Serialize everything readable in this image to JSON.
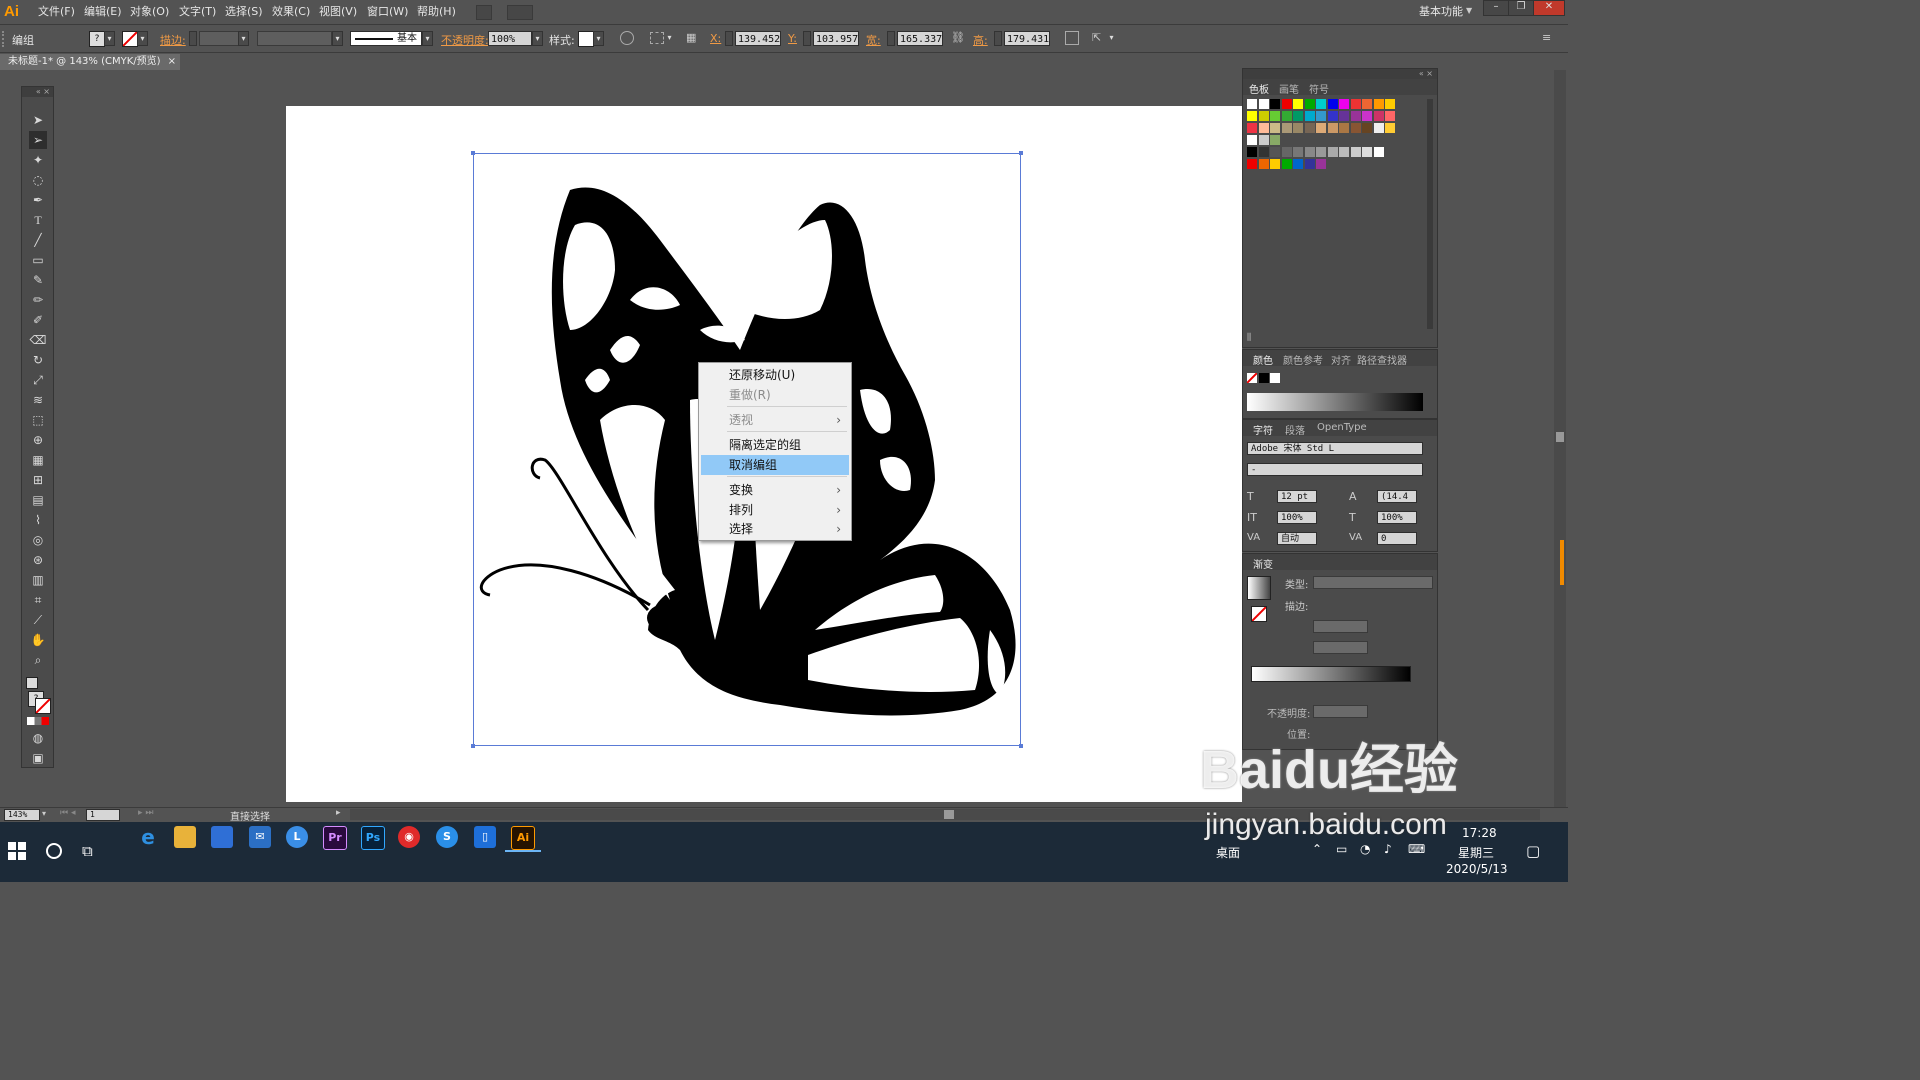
{
  "app": {
    "logo": "Ai",
    "workspace": "基本功能"
  },
  "menu": [
    "文件(F)",
    "编辑(E)",
    "对象(O)",
    "文字(T)",
    "选择(S)",
    "效果(C)",
    "视图(V)",
    "窗口(W)",
    "帮助(H)"
  ],
  "control_bar": {
    "selection_label": "编组",
    "stroke_label": "描边:",
    "stroke_style": "基本",
    "opacity_label": "不透明度:",
    "opacity_value": "100%",
    "style_label": "样式:",
    "x_label": "X:",
    "x_value": "139.452 ",
    "y_label": "Y:",
    "y_value": "103.957 ",
    "w_label": "宽:",
    "w_value": "165.337 ",
    "h_label": "高:",
    "h_value": "179.431 "
  },
  "document_tab": {
    "title": "未标题-1* @ 143% (CMYK/预览)",
    "close": "×"
  },
  "context_menu": {
    "items": [
      {
        "label": "还原移动(U)",
        "enabled": true
      },
      {
        "label": "重做(R)",
        "enabled": false
      },
      {
        "label": "透视",
        "enabled": false,
        "submenu": true
      },
      {
        "label": "隔离选定的组",
        "enabled": true
      },
      {
        "label": "取消编组",
        "enabled": true,
        "highlighted": true
      },
      {
        "label": "变换",
        "enabled": true,
        "submenu": true
      },
      {
        "label": "排列",
        "enabled": true,
        "submenu": true
      },
      {
        "label": "选择",
        "enabled": true,
        "submenu": true
      }
    ],
    "arrow": "›"
  },
  "swatches_panel": {
    "tabs": [
      "色板",
      "画笔",
      "符号"
    ]
  },
  "color_panel": {
    "tabs": [
      "颜色",
      "颜色参考",
      "对齐",
      "路径查找器"
    ]
  },
  "character_panel": {
    "tabs": [
      "字符",
      "段落",
      "OpenType"
    ],
    "font_family": "Adobe 宋体 Std L",
    "font_style": "-",
    "font_size": "12 pt",
    "leading": "(14.4",
    "vertical_scale": "100%",
    "horizontal_scale": "100%",
    "kerning": "自动",
    "tracking": "0"
  },
  "gradient_panel": {
    "tab": "渐变",
    "type_label": "类型:",
    "stroke_label": "描边:",
    "opacity_label": "不透明度:",
    "position_label": "位置:"
  },
  "status_bar": {
    "zoom": "143%",
    "page": "1",
    "tool": "直接选择"
  },
  "taskbar": {
    "desktop_label": "桌面",
    "time": "17:28",
    "weekday": "星期三",
    "date": "2020/5/13"
  },
  "watermark": {
    "text": "Baidu经验",
    "url": "jingyan.baidu.com"
  },
  "colors": {
    "ui_bg": "#535353",
    "panel_bg": "#4b4b4b",
    "selection_blue": "#5a7bd6",
    "menu_highlight": "#91c9f7",
    "accent_orange": "#ff9a00",
    "taskbar": "#1c2a38"
  }
}
